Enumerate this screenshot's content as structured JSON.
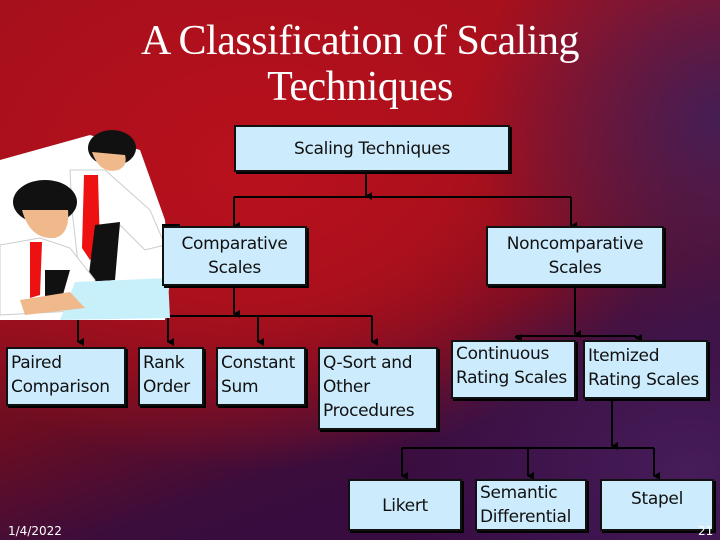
{
  "slide": {
    "title_lines": [
      "A Classification of Scaling",
      "Techniques"
    ],
    "footer_date": "1/4/2022",
    "slide_number": "21",
    "clipart": "two-businessmen-at-computer"
  },
  "colors": {
    "node_fill": "#ccebfc",
    "node_border": "#111111",
    "connector": "#000000",
    "title_text": "#ffffff",
    "background_red": "#b0101c",
    "background_purple": "#3a0d4a"
  },
  "tree": {
    "root": "Scaling Techniques",
    "comparative": {
      "label_lines": [
        "Comparative",
        "Scales"
      ],
      "children": [
        {
          "lines": [
            "Paired",
            "Comparison"
          ]
        },
        {
          "lines": [
            "Rank",
            "Order"
          ]
        },
        {
          "lines": [
            "Constant",
            "Sum"
          ]
        },
        {
          "lines": [
            "Q-Sort and",
            "Other",
            "Procedures"
          ]
        }
      ]
    },
    "noncomparative": {
      "label_lines": [
        "Noncomparative",
        "Scales"
      ],
      "children": [
        {
          "lines": [
            "Continuous",
            "Rating Scales"
          ]
        },
        {
          "lines": [
            "Itemized",
            "Rating Scales"
          ]
        }
      ]
    },
    "itemized": {
      "children": [
        {
          "lines": [
            "Likert"
          ]
        },
        {
          "lines": [
            "Semantic",
            "Differential"
          ]
        },
        {
          "lines": [
            "Stapel"
          ]
        }
      ]
    }
  }
}
